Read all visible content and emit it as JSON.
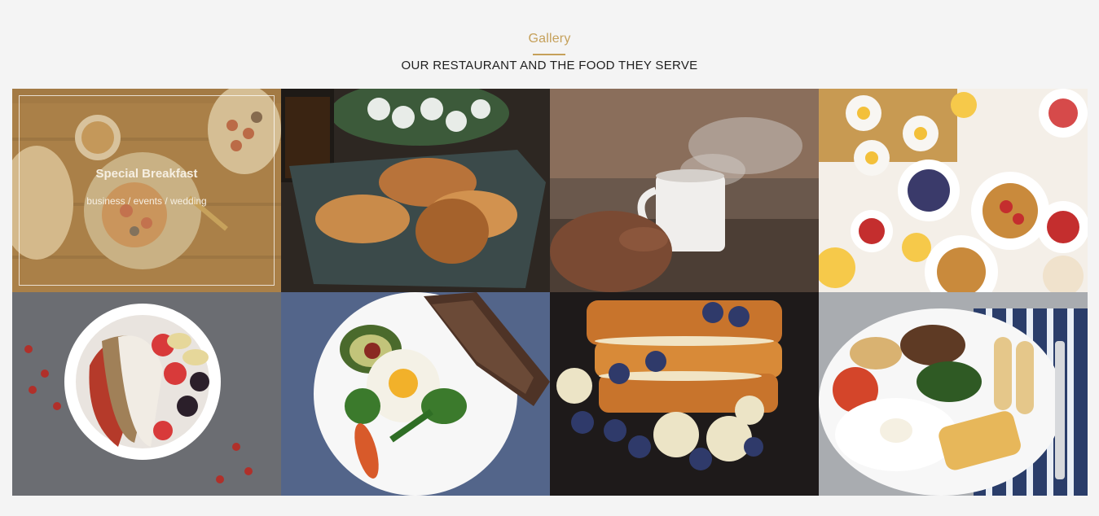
{
  "section": {
    "eyebrow": "Gallery",
    "title": "OUR RESTAURANT AND THE FOOD THEY SERVE"
  },
  "gallery": {
    "hover_caption": {
      "title": "Special Breakfast",
      "subtitle": "business / events / wedding"
    },
    "photos": [
      {
        "subject": "breakfast-table-photo"
      },
      {
        "subject": "croissants-photo"
      },
      {
        "subject": "coffee-cup-photo"
      },
      {
        "subject": "waffles-brunch-photo"
      },
      {
        "subject": "smoothie-bowl-photo"
      },
      {
        "subject": "avocado-egg-plate-photo"
      },
      {
        "subject": "french-toast-photo"
      },
      {
        "subject": "english-breakfast-photo"
      }
    ]
  },
  "colors": {
    "accent": "#c5a05a",
    "background": "#f4f4f4",
    "title_text": "#1e1e1e"
  }
}
